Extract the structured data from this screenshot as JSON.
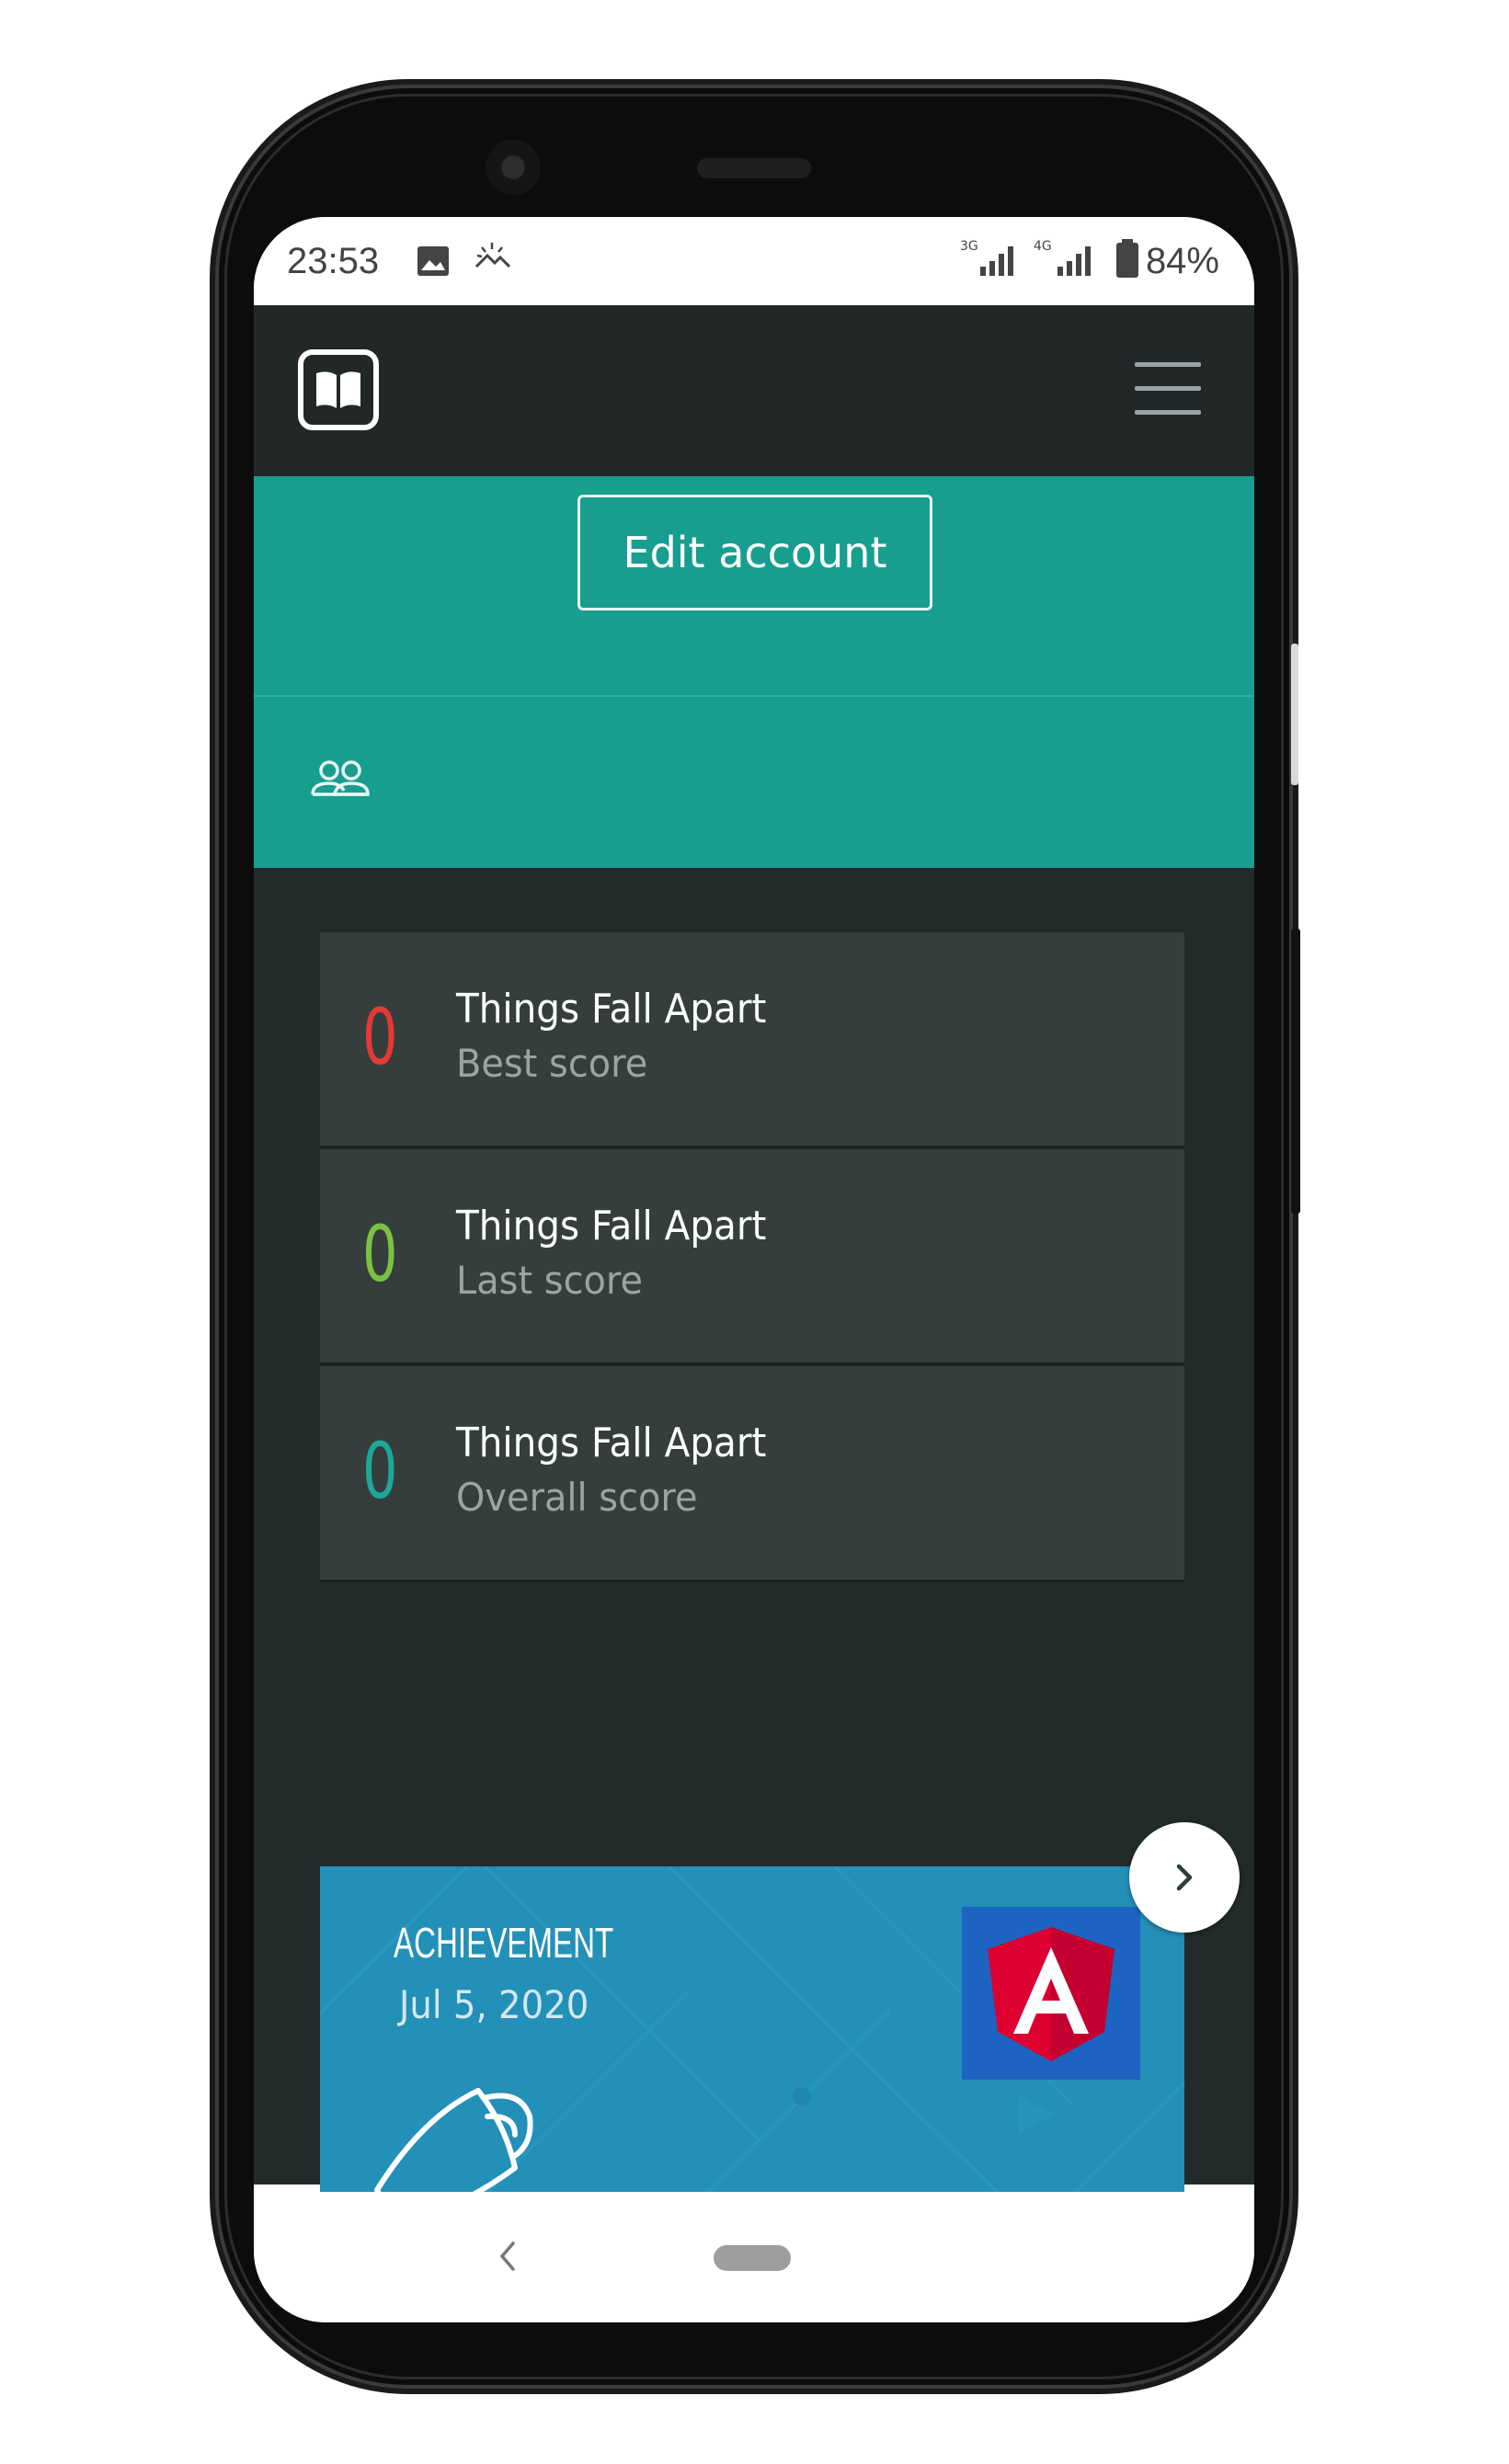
{
  "status_bar": {
    "time": "23:53",
    "network_3g": "3G",
    "network_4g": "4G",
    "battery": "84%",
    "icons": [
      "image-icon",
      "weather-icon",
      "signal-icon",
      "signal-icon",
      "battery-icon"
    ]
  },
  "header": {
    "logo_icon": "book-icon",
    "menu_icon": "hamburger-menu-icon"
  },
  "profile": {
    "edit_button": "Edit account",
    "group_icon": "group-icon"
  },
  "scores": [
    {
      "value": "0",
      "title": "Things Fall Apart",
      "label": "Best score",
      "color": "#e53935"
    },
    {
      "value": "0",
      "title": "Things Fall Apart",
      "label": "Last score",
      "color": "#7cc242"
    },
    {
      "value": "0",
      "title": "Things Fall Apart",
      "label": "Overall score",
      "color": "#1ea79b"
    }
  ],
  "achievement": {
    "label": "ACHIEVEMENT",
    "date": "Jul 5, 2020",
    "badge_icon": "angular-icon",
    "trophy_icon": "trophy-icon",
    "next_icon": "chevron-right-icon"
  },
  "system_nav": {
    "back_icon": "back-chevron-icon",
    "home_icon": "home-pill-icon"
  },
  "colors": {
    "header_bg": "#222828",
    "teal": "#179e8f",
    "content_bg": "#232a2a",
    "card_bg": "#353e3c",
    "achievement_bg": "#2390b8"
  }
}
